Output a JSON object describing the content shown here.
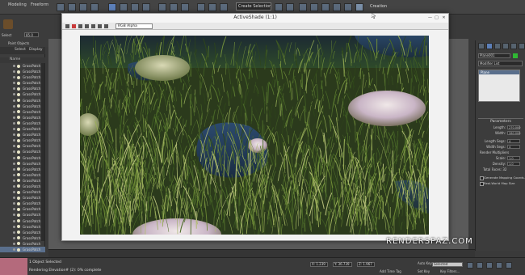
{
  "menubar": {
    "modeling": "Modeling",
    "freeform": "Freeform",
    "selection_set": "Create Selection Se",
    "workspace": "Creation"
  },
  "ribbon": {
    "label1": "Select",
    "label2": "Paint Objects",
    "field_value": "85.0"
  },
  "explorer": {
    "tab_select": "Select",
    "tab_display": "Display",
    "header": "Name",
    "items": [
      "GrassPatch",
      "GrassPatch",
      "GrassPatch",
      "GrassPatch",
      "GrassPatch",
      "GrassPatch",
      "GrassPatch",
      "GrassPatch",
      "GrassPatch",
      "GrassPatch",
      "GrassPatch",
      "GrassPatch",
      "GrassPatch",
      "GrassPatch",
      "GrassPatch",
      "GrassPatch",
      "GrassPatch",
      "GrassPatch",
      "GrassPatch",
      "GrassPatch",
      "GrassPatch",
      "GrassPatch",
      "GrassPatch",
      "GrassPatch",
      "GrassPatch",
      "GrassPatch",
      "GrassPatch",
      "GrassPatch",
      "GrassPatch",
      "GrassPatch",
      "GrassPatch",
      "GrassPatch",
      "GrassPatch"
    ]
  },
  "activeshade": {
    "title": "ActiveShade (1:1)",
    "channel": "RGB Alpha",
    "minimize": "—",
    "maximize": "□",
    "close": "✕"
  },
  "command_panel": {
    "object_name": "Plane001",
    "object_color": "#2fb833",
    "modifier_list": "Modifier List",
    "stack_item": "Plane",
    "parameters_title": "Parameters",
    "length_label": "Length:",
    "length_value": "270.000",
    "width_label": "Width:",
    "width_value": "280.000",
    "length_segs_label": "Length Segs:",
    "length_segs_value": "4",
    "width_segs_label": "Width Segs:",
    "width_segs_value": "4",
    "render_multipliers": "Render Multipliers",
    "scale_label": "Scale:",
    "scale_value": "1.0",
    "density_label": "Density:",
    "density_value": "1.0",
    "total_faces": "Total Faces: 32",
    "gen_mapping": "Generate Mapping Coords.",
    "real_world": "Real-World Map Size"
  },
  "status": {
    "line1": "1 Object Selected",
    "line2": "Rendering Elevation# (2): 0% complete",
    "x_value": "X: 1.239",
    "y_value": "Y: 36.739",
    "z_value": "Z: 1.967",
    "auto_key": "Auto Key",
    "selected": "Selected",
    "set_key": "Set Key",
    "key_filters": "Key Filters...",
    "add_time_tag": "Add Time Tag"
  },
  "watermark": "RENDERSPAZ.COM"
}
